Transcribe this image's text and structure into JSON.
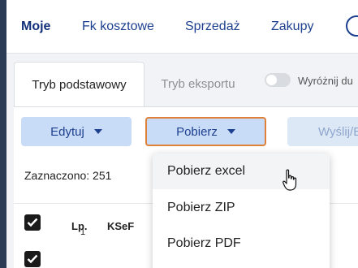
{
  "nav": {
    "items": [
      "Moje",
      "Fk kosztowe",
      "Sprzedaż",
      "Zakupy"
    ],
    "active": "Moje"
  },
  "tabs": {
    "basic": "Tryb podstawowy",
    "export": "Tryb eksportu"
  },
  "toggle": {
    "label": "Wyróżnij du",
    "on": false
  },
  "toolbar": {
    "edit_label": "Edytuj",
    "download_label": "Pobierz",
    "send_label": "Wyślij/E"
  },
  "selection": {
    "text": "Zaznaczono: 251"
  },
  "table": {
    "columns": [
      "Lp.",
      "KSeF"
    ],
    "first_row_number": "1"
  },
  "dropdown": {
    "items": [
      "Pobierz excel",
      "Pobierz ZIP",
      "Pobierz PDF"
    ],
    "hovered": "Pobierz excel"
  },
  "colors": {
    "nav_text": "#1d3f8f",
    "button_bg": "#c9dcf7",
    "focus_border": "#e0813a"
  }
}
